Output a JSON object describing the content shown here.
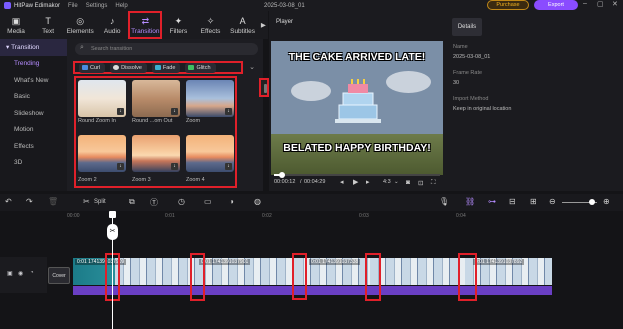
{
  "titlebar": {
    "app": "HitPaw Edimakor",
    "menu": [
      "File",
      "Settings",
      "Help"
    ],
    "project": "2025-03-08_01",
    "purchase": "Purchase",
    "export": "Export"
  },
  "toolbar": {
    "items": [
      {
        "label": "Media",
        "icon": "▣"
      },
      {
        "label": "Text",
        "icon": "T"
      },
      {
        "label": "Elements",
        "icon": "◎"
      },
      {
        "label": "Audio",
        "icon": "♪"
      },
      {
        "label": "Transition",
        "icon": "⇄"
      },
      {
        "label": "Filters",
        "icon": "✦"
      },
      {
        "label": "Effects",
        "icon": "✧"
      },
      {
        "label": "Subtitles",
        "icon": "A"
      }
    ],
    "more": "▶"
  },
  "categories": [
    "Transition",
    "Trending",
    "What's New",
    "Basic",
    "Slideshow",
    "Motion",
    "Effects",
    "3D"
  ],
  "panel": {
    "search_placeholder": "Search transition",
    "chips": [
      {
        "label": "Curl",
        "color": "#4a8be0"
      },
      {
        "label": "Dissolve",
        "color": "#dddddd"
      },
      {
        "label": "Fade",
        "color": "#3ab0d0"
      },
      {
        "label": "Glitch",
        "color": "#40c060"
      }
    ],
    "chevron": "⌄",
    "items": [
      "Round Zoom In",
      "Round ...om Out",
      "Zoom",
      "Zoom 2",
      "Zoom 3",
      "Zoom 4"
    ]
  },
  "player": {
    "label": "Player",
    "top_text": "THE CAKE ARRIVED LATE!",
    "bottom_text": "BELATED HAPPY BIRTHDAY!",
    "time_current": "00:00:12",
    "time_total": "00:04:29",
    "progress": 0.05,
    "ratio": "4:3"
  },
  "details": {
    "tab": "Details",
    "fields": [
      {
        "key": "Name",
        "value": "2025-03-08_01"
      },
      {
        "key": "Frame Rate",
        "value": "30"
      },
      {
        "key": "Import Method",
        "value": "Keep in original location"
      }
    ]
  },
  "timeline_toolbar": {
    "split": "Split"
  },
  "timeline": {
    "ruler": [
      "00:00",
      "0:01",
      "0:02",
      "0:03",
      "0:04"
    ],
    "cover": "Cover",
    "clips": [
      {
        "label": "0:01  1741391037909"
      },
      {
        "label": "0:01  1741391037901"
      },
      {
        "label": "0:01  1741391037338"
      },
      {
        "label": "0:01  1741391037892"
      }
    ]
  }
}
